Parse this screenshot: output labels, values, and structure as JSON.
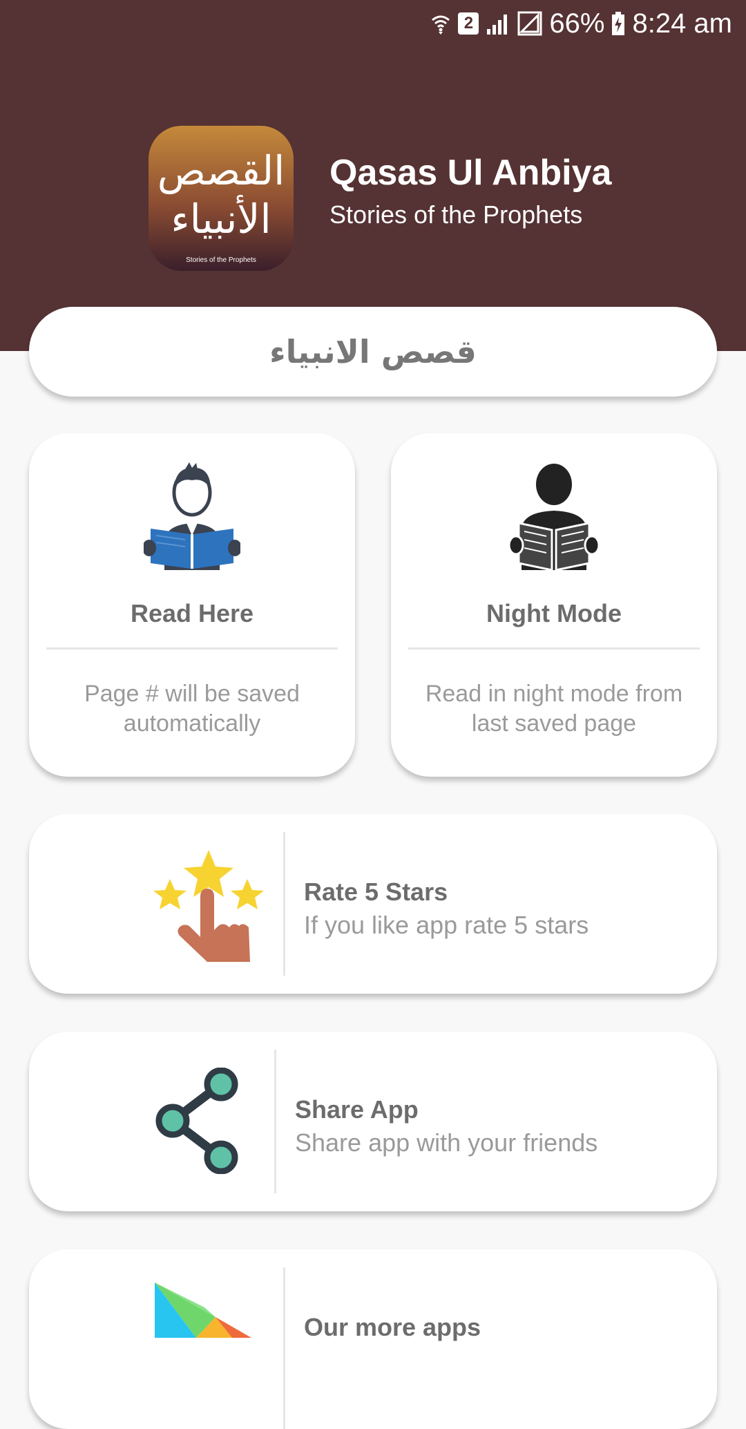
{
  "status_bar": {
    "battery": "66%",
    "time": "8:24 am",
    "sim_number": "2"
  },
  "header": {
    "logo_arabic": "القصص الأنبياء",
    "logo_caption": "Stories of the Prophets",
    "title": "Qasas Ul Anbiya",
    "subtitle": "Stories of the Prophets"
  },
  "banner": {
    "text": "قصص الانبياء"
  },
  "cards": {
    "read": {
      "icon": "reading-person-icon",
      "title": "Read Here",
      "description": "Page # will be saved automatically"
    },
    "night": {
      "icon": "night-reader-icon",
      "title": "Night Mode",
      "description": "Read in night mode from last saved page"
    }
  },
  "list": [
    {
      "icon": "rate-stars-icon",
      "title": "Rate 5 Stars",
      "description": "If you like app rate 5 stars"
    },
    {
      "icon": "share-icon",
      "title": "Share App",
      "description": "Share app with your friends"
    },
    {
      "icon": "play-store-icon",
      "title": "Our more apps",
      "description": ""
    }
  ],
  "colors": {
    "header": "#553233",
    "accent_blue": "#2e73bd",
    "star": "#f7d332",
    "share_teal": "#5fc2a6"
  }
}
